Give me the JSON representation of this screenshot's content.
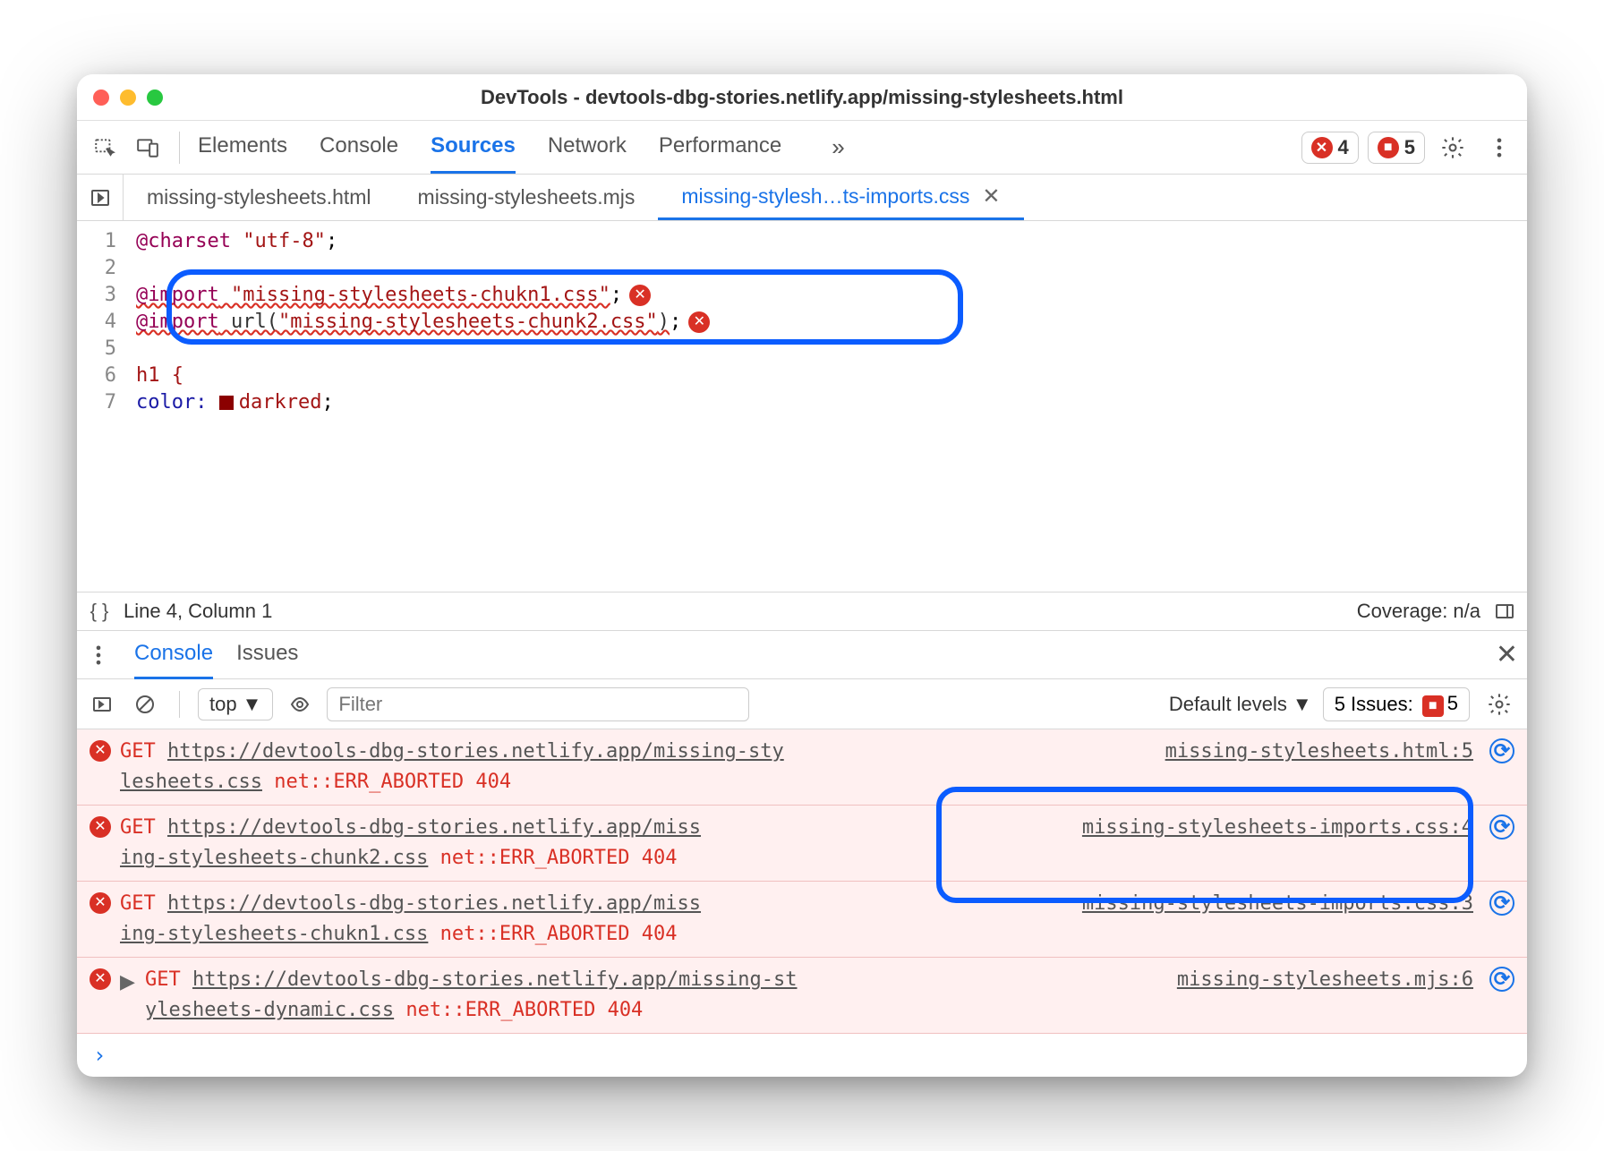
{
  "window": {
    "title": "DevTools - devtools-dbg-stories.netlify.app/missing-stylesheets.html"
  },
  "panel_tabs": {
    "elements": "Elements",
    "console": "Console",
    "sources": "Sources",
    "network": "Network",
    "performance": "Performance"
  },
  "toolbar_right": {
    "errors_count": "4",
    "issues_count": "5"
  },
  "file_tabs": {
    "t0": "missing-stylesheets.html",
    "t1": "missing-stylesheets.mjs",
    "t2": "missing-stylesh…ts-imports.css"
  },
  "source": {
    "lines": {
      "l1_kw": "@charset",
      "l1_str": " \"utf-8\"",
      "l3_kw": "@import",
      "l3_str": " \"missing-stylesheets-chukn1.css\"",
      "l4_kw": "@import",
      "l4_fn": " url(",
      "l4_str": "\"missing-stylesheets-chunk2.css\"",
      "l4_close": ")",
      "l6_sel": "h1 {",
      "l7_prop": "    color:",
      "l7_val": "darkred"
    },
    "line_nums": {
      "1": "1",
      "2": "2",
      "3": "3",
      "4": "4",
      "5": "5",
      "6": "6",
      "7": "7"
    }
  },
  "statusbar": {
    "pos": "Line 4, Column 1",
    "coverage": "Coverage: n/a"
  },
  "drawer_tabs": {
    "console": "Console",
    "issues": "Issues"
  },
  "console_toolbar": {
    "context": "top",
    "filter_placeholder": "Filter",
    "levels": "Default levels",
    "issues_label": "5 Issues:",
    "issues_count": "5"
  },
  "messages": [
    {
      "method": "GET ",
      "url1": "https://devtools-dbg-stories.netlify.app/missing-sty",
      "url2": "lesheets.css",
      "err": " net::ERR_ABORTED 404",
      "src": "missing-stylesheets.html:5"
    },
    {
      "method": "GET ",
      "url1": "https://devtools-dbg-stories.netlify.app/miss",
      "url2": "ing-stylesheets-chunk2.css",
      "err": " net::ERR_ABORTED 404",
      "src": "missing-stylesheets-imports.css:4"
    },
    {
      "method": "GET ",
      "url1": "https://devtools-dbg-stories.netlify.app/miss",
      "url2": "ing-stylesheets-chukn1.css",
      "err": " net::ERR_ABORTED 404",
      "src": "missing-stylesheets-imports.css:3"
    },
    {
      "method": "GET ",
      "url1": "https://devtools-dbg-stories.netlify.app/missing-st",
      "url2": "ylesheets-dynamic.css",
      "err": " net::ERR_ABORTED 404",
      "src": "missing-stylesheets.mjs:6"
    }
  ]
}
